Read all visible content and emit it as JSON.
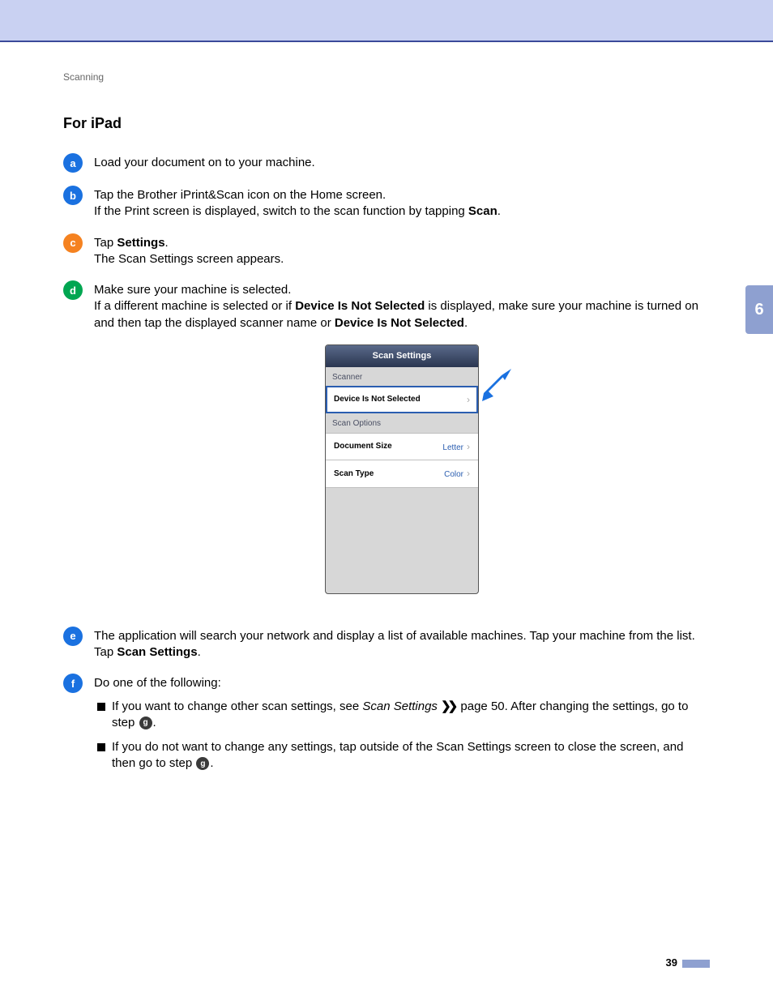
{
  "breadcrumb": "Scanning",
  "heading": "For iPad",
  "steps": {
    "s1": "Load your document on to your machine.",
    "s2a": "Tap the Brother iPrint&Scan icon on the Home screen.",
    "s2b_pre": "If the Print screen is displayed, switch to the scan function by tapping ",
    "s2b_bold": "Scan",
    "s2b_post": ".",
    "s3a_pre": "Tap ",
    "s3a_bold": "Settings",
    "s3a_post": ".",
    "s3b": "The Scan Settings screen appears.",
    "s4a": "Make sure your machine is selected.",
    "s4b_pre": "If a different machine is selected or if ",
    "s4b_bold1": "Device Is Not Selected",
    "s4b_mid": " is displayed, make sure your machine is turned on and then tap the displayed scanner name or ",
    "s4b_bold2": "Device Is Not Selected",
    "s4b_post": ".",
    "s5a": "The application will search your network and display a list of available machines. Tap your machine from the list.",
    "s5b_pre": "Tap ",
    "s5b_bold": "Scan Settings",
    "s5b_post": ".",
    "s6": "Do one of the following:"
  },
  "bullets": {
    "b1_pre": "If you want to change other scan settings, see ",
    "b1_italic": "Scan Settings",
    "b1_mid": " page 50. After changing the settings, go to step ",
    "b1_ref": "g",
    "b1_post": ".",
    "b2_pre": "If you do not want to change any settings, tap outside of the Scan Settings screen to close the screen, and then go to step ",
    "b2_ref": "g",
    "b2_post": "."
  },
  "panel": {
    "title": "Scan Settings",
    "scanner_label": "Scanner",
    "device_row": "Device Is Not Selected",
    "options_label": "Scan Options",
    "docsize_k": "Document Size",
    "docsize_v": "Letter",
    "scantype_k": "Scan Type",
    "scantype_v": "Color"
  },
  "side_tab": "6",
  "page_number": "39",
  "step_numbers": {
    "n1": "a",
    "n2": "b",
    "n3": "c",
    "n4": "d",
    "n5": "e",
    "n6": "f"
  }
}
